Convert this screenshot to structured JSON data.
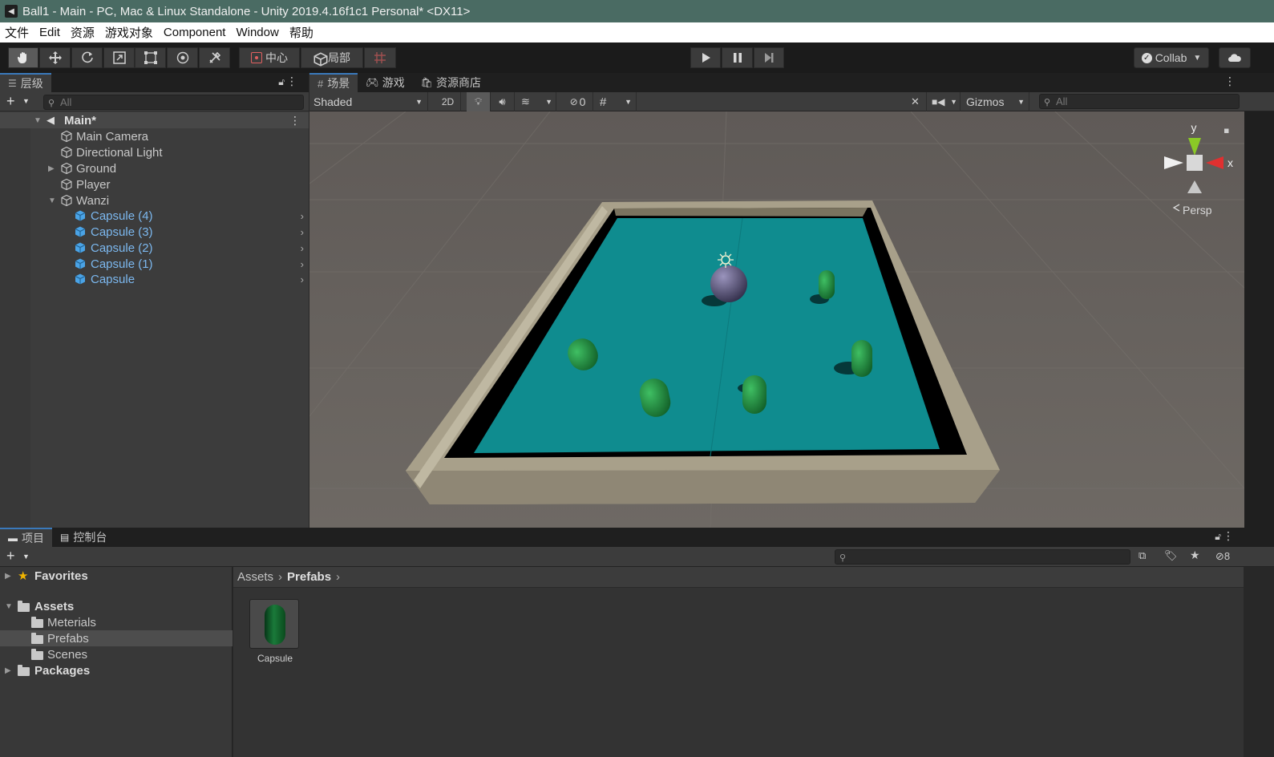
{
  "window": {
    "title": "Ball1 - Main - PC, Mac & Linux Standalone - Unity 2019.4.16f1c1 Personal* <DX11>"
  },
  "menu": [
    "文件",
    "Edit",
    "资源",
    "游戏对象",
    "Component",
    "Window",
    "帮助"
  ],
  "toolbar": {
    "pivot_label": "中心",
    "space_label": "局部",
    "collab_label": "Collab"
  },
  "hierarchy": {
    "tab_label": "层级",
    "search_placeholder": "All",
    "scene_name": "Main*",
    "items": [
      {
        "label": "Main Camera",
        "prefab": false
      },
      {
        "label": "Directional Light",
        "prefab": false
      },
      {
        "label": "Ground",
        "prefab": false
      },
      {
        "label": "Player",
        "prefab": false
      },
      {
        "label": "Wanzi",
        "prefab": false
      },
      {
        "label": "Capsule (4)",
        "prefab": true
      },
      {
        "label": "Capsule (3)",
        "prefab": true
      },
      {
        "label": "Capsule (2)",
        "prefab": true
      },
      {
        "label": "Capsule (1)",
        "prefab": true
      },
      {
        "label": "Capsule",
        "prefab": true
      }
    ]
  },
  "scene": {
    "tabs": [
      "场景",
      "游戏",
      "资源商店"
    ],
    "shading_mode": "Shaded",
    "mode_2d": "2D",
    "hidden_count": "0",
    "gizmos_label": "Gizmos",
    "search_placeholder": "All",
    "gizmo_axis_y": "y",
    "gizmo_axis_x": "x",
    "projection_label": "Persp",
    "colors": {
      "ground": "#0f8c8f",
      "wall": "#a8a08a",
      "capsule": "#1e8a3a",
      "player": "#5a5478"
    }
  },
  "project": {
    "tabs": [
      "项目",
      "控制台"
    ],
    "hidden_count": "8",
    "tree": {
      "favorites": "Favorites",
      "assets": "Assets",
      "folders": [
        "Meterials",
        "Prefabs",
        "Scenes"
      ],
      "packages": "Packages"
    },
    "breadcrumb": [
      "Assets",
      "Prefabs"
    ],
    "asset_items": [
      {
        "label": "Capsule"
      }
    ]
  }
}
